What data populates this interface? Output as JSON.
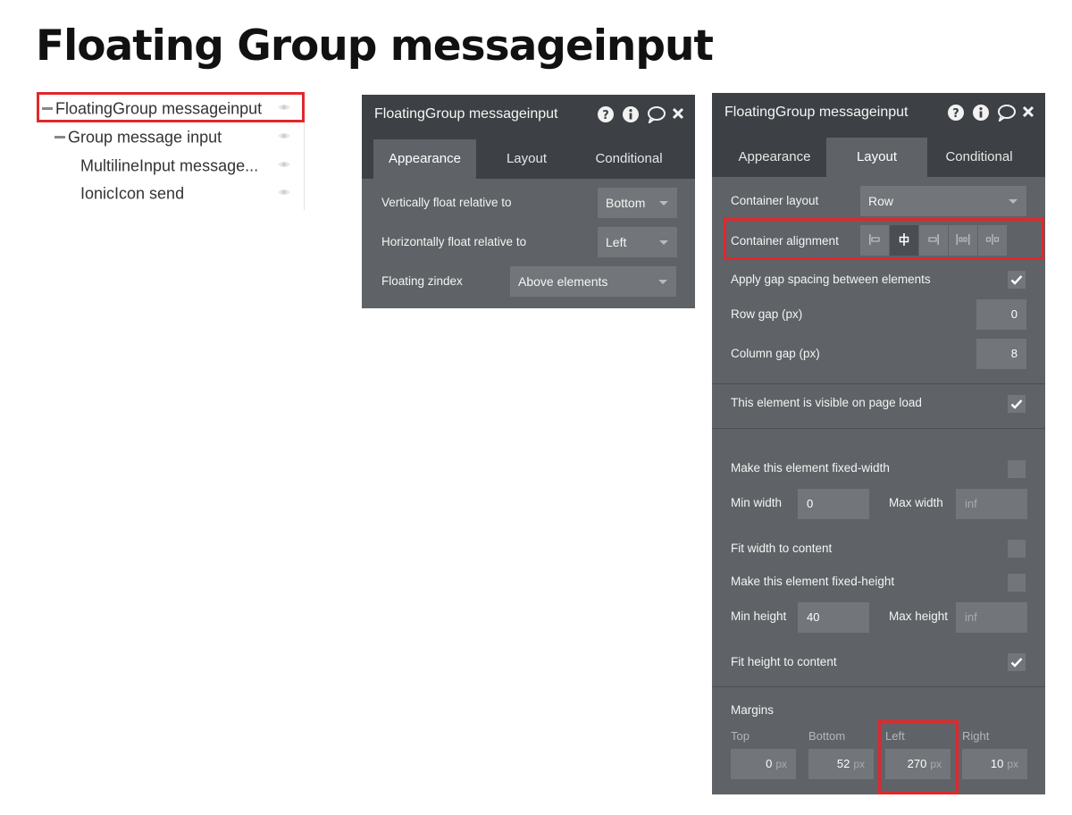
{
  "page": {
    "title": "Floating Group messageinput"
  },
  "tree": {
    "items": [
      {
        "label": "FloatingGroup messageinput"
      },
      {
        "label": "Group message input"
      },
      {
        "label": "MultilineInput message..."
      },
      {
        "label": "IonicIcon send"
      }
    ]
  },
  "panel_appearance": {
    "title": "FloatingGroup messageinput",
    "tabs": [
      "Appearance",
      "Layout",
      "Conditional"
    ],
    "active_tab": "Appearance",
    "fields": {
      "vfloat_label": "Vertically float relative to",
      "vfloat_value": "Bottom",
      "hfloat_label": "Horizontally float relative to",
      "hfloat_value": "Left",
      "zindex_label": "Floating zindex",
      "zindex_value": "Above elements"
    }
  },
  "panel_layout": {
    "title": "FloatingGroup messageinput",
    "tabs": [
      "Appearance",
      "Layout",
      "Conditional"
    ],
    "active_tab": "Layout",
    "container_layout_label": "Container layout",
    "container_layout_value": "Row",
    "container_alignment_label": "Container alignment",
    "apply_gap_label": "Apply gap spacing between elements",
    "apply_gap_checked": true,
    "row_gap_label": "Row gap (px)",
    "row_gap_value": "0",
    "column_gap_label": "Column gap (px)",
    "column_gap_value": "8",
    "visible_label": "This element is visible on page load",
    "visible_checked": true,
    "fixed_width_label": "Make this element fixed-width",
    "fixed_width_checked": false,
    "min_width_label": "Min width",
    "min_width_value": "0",
    "max_width_label": "Max width",
    "max_width_placeholder": "inf",
    "fit_width_label": "Fit width to content",
    "fit_width_checked": false,
    "fixed_height_label": "Make this element fixed-height",
    "fixed_height_checked": false,
    "min_height_label": "Min height",
    "min_height_value": "40",
    "max_height_label": "Max height",
    "max_height_placeholder": "inf",
    "fit_height_label": "Fit height to content",
    "fit_height_checked": true,
    "margins_label": "Margins",
    "margins": {
      "top_label": "Top",
      "top_value": "0",
      "bottom_label": "Bottom",
      "bottom_value": "52",
      "left_label": "Left",
      "left_value": "270",
      "right_label": "Right",
      "right_value": "10",
      "unit": "px"
    }
  },
  "icons": {
    "header": [
      "help-icon",
      "info-icon",
      "comment-icon",
      "close-icon"
    ],
    "alignment": [
      "align-left-icon",
      "align-center-icon",
      "align-right-icon",
      "space-between-icon",
      "space-around-icon"
    ],
    "tree": "eye-icon"
  },
  "colors": {
    "panel_bg": "#5f6266",
    "panel_header": "#3d4044",
    "highlight": "#e0282c"
  }
}
